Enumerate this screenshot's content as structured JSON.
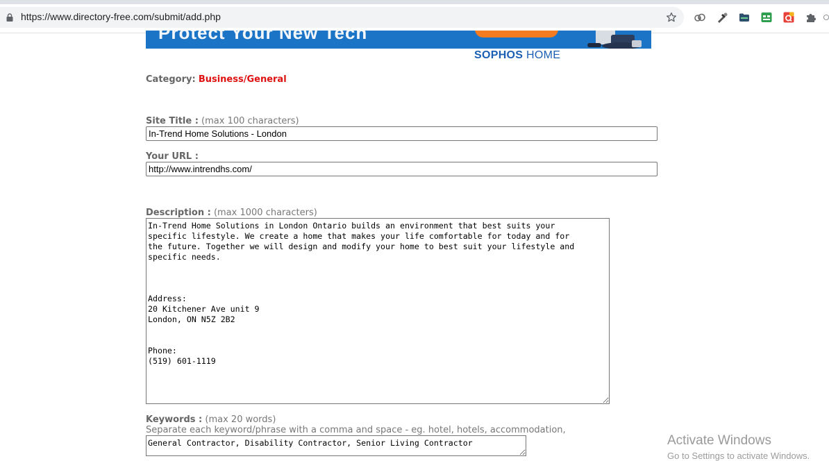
{
  "browser": {
    "url": "https://www.directory-free.com/submit/add.php"
  },
  "banner": {
    "headline": "Protect Your New Tech",
    "logo_bold": "SOPHOS",
    "logo_light": " HOME"
  },
  "form": {
    "category": {
      "label": "Category:",
      "value": "Business/General"
    },
    "site_title": {
      "label": "Site Title :",
      "hint": " (max 100 characters)",
      "value": "In-Trend Home Solutions - London"
    },
    "url": {
      "label": "Your URL :",
      "value": "http://www.intrendhs.com/"
    },
    "description": {
      "label": "Description :",
      "hint": " (max 1000 characters)",
      "value": "In-Trend Home Solutions in London Ontario builds an environment that best suits your\nspecific lifestyle. We create a home that makes your life comfortable for today and for\nthe future. Together we will design and modify your home to best suit your lifestyle and\nspecific needs.\n\n\n\nAddress:\n20 Kitchener Ave unit 9\nLondon, ON N5Z 2B2\n\n\nPhone:\n(519) 601-1119"
    },
    "keywords": {
      "label": "Keywords :",
      "hint": " (max 20 words)",
      "instruction": "Separate each keyword/phrase with a comma and space - eg. hotel, hotels, accommodation,",
      "value": "General Contractor, Disability Contractor, Senior Living Contractor"
    }
  },
  "watermark": {
    "title": "Activate Windows",
    "subtitle": "Go to Settings to activate Windows."
  },
  "colors": {
    "category_value": "#e01010",
    "banner_blue": "#1b74c5",
    "label_gray": "#666666"
  }
}
